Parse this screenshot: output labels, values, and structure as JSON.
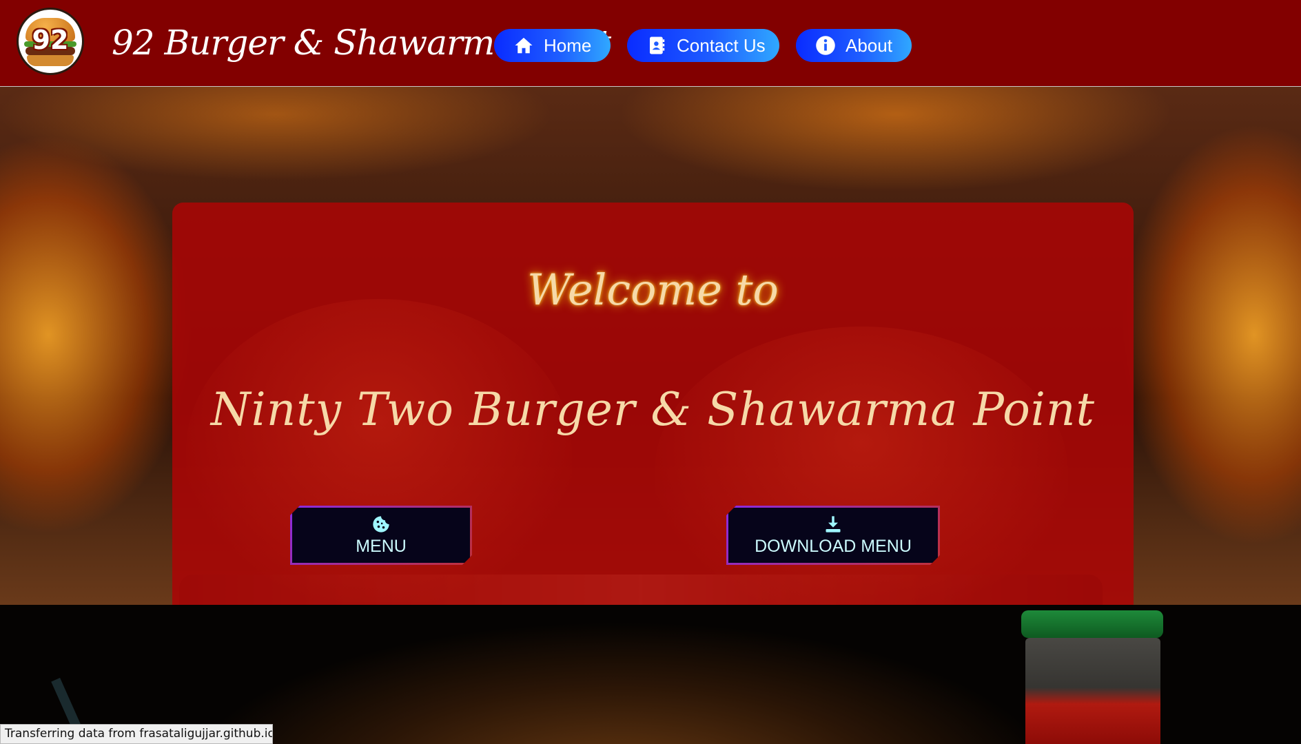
{
  "header": {
    "logo_text": "92",
    "brand": "92 Burger & Shawarma Point",
    "nav": [
      {
        "label": "Home",
        "icon": "home-icon"
      },
      {
        "label": "Contact Us",
        "icon": "contact-book-icon"
      },
      {
        "label": "About",
        "icon": "info-icon"
      }
    ]
  },
  "hero": {
    "welcome": "Welcome to",
    "full_name": "Ninty Two Burger & Shawarma Point",
    "buttons": [
      {
        "label": "MENU",
        "icon": "cookie-icon"
      },
      {
        "label": "DOWNLOAD MENU",
        "icon": "download-icon"
      }
    ]
  },
  "status_bar": {
    "text": "Transferring data from frasataligujjar.github.io..."
  },
  "colors": {
    "header_bg": "#820000",
    "card_bg": "#aa0606",
    "nav_gradient_start": "#0a2cff",
    "nav_gradient_end": "#30a8ff",
    "script_text": "#f6d9a8",
    "button_bg": "#06041a",
    "button_text": "#ccfbff"
  }
}
